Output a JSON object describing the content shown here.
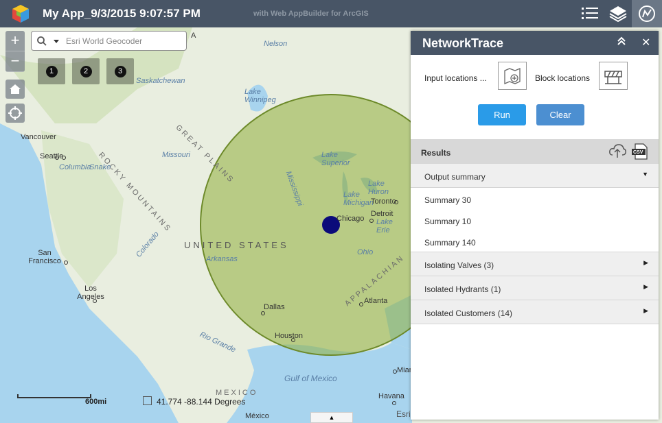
{
  "header": {
    "title": "My App_9/3/2015 9:07:57 PM",
    "subtitle": "with Web AppBuilder for ArcGIS",
    "buttons": [
      "list-icon",
      "layers-icon",
      "network-trace-icon"
    ]
  },
  "map": {
    "search_placeholder": "Esri World Geocoder",
    "zoom_in": "+",
    "zoom_out": "−",
    "widgets": [
      "1",
      "2",
      "3"
    ],
    "labels": {
      "canada_letter": "A",
      "nelson": "Nelson",
      "saskatchewan": "Saskatchewan",
      "lake_winnipeg": "Lake Winnipeg",
      "rocky": "ROCKY MOUNTAINS",
      "great_plains": "GREAT PLAINS",
      "missouri": "Missouri",
      "vancouver": "Vancouver",
      "seattle": "Seattle",
      "columbia": "Columbia",
      "snake": "Snake",
      "lake_superior": "Lake Superior",
      "lake_huron": "Lake Huron",
      "lake_michigan": "Lake Michigan",
      "toronto": "Toronto",
      "detroit": "Detroit",
      "lake_erie": "Lake Erie",
      "chicago": "Chicago",
      "mississippi": "Mississippi",
      "united_states": "UNITED STATES",
      "arkansas": "Arkansas",
      "ohio": "Ohio",
      "appalachian": "APPALACHIAN",
      "san_francisco": "San Francisco",
      "los_angeles": "Los Angeles",
      "colorado": "Colorado",
      "dallas": "Dallas",
      "atlanta": "Atlanta",
      "houston": "Houston",
      "rio_grande": "Rio Grande",
      "gulf": "Gulf of Mexico",
      "mexico": "MEXICO",
      "mexico_city": "México",
      "havana": "Havana",
      "miami": "Miami"
    },
    "scale_label": "600mi",
    "coordinates": "41.774 -88.144 Degrees",
    "attribution": "Esri",
    "collapse_arrow": "▲"
  },
  "panel": {
    "title": "NetworkTrace",
    "collapse_icon": "«",
    "close_icon": "✕",
    "input_locations_label": "Input locations ...",
    "block_locations_label": "Block locations",
    "run_label": "Run",
    "clear_label": "Clear",
    "results_label": "Results",
    "output_summary": {
      "label": "Output summary",
      "items": [
        "Summary 30",
        "Summary 10",
        "Summary 140"
      ]
    },
    "groups": [
      {
        "label": "Isolating Valves (3)"
      },
      {
        "label": "Isolated Hydrants (1)"
      },
      {
        "label": "Isolated Customers (14)"
      }
    ]
  },
  "colors": {
    "header": "#485566",
    "run_button": "#2a9be8",
    "clear_button": "#4c8fd1",
    "buffer_fill": "#8fae3a",
    "point": "#0b0b7a"
  }
}
